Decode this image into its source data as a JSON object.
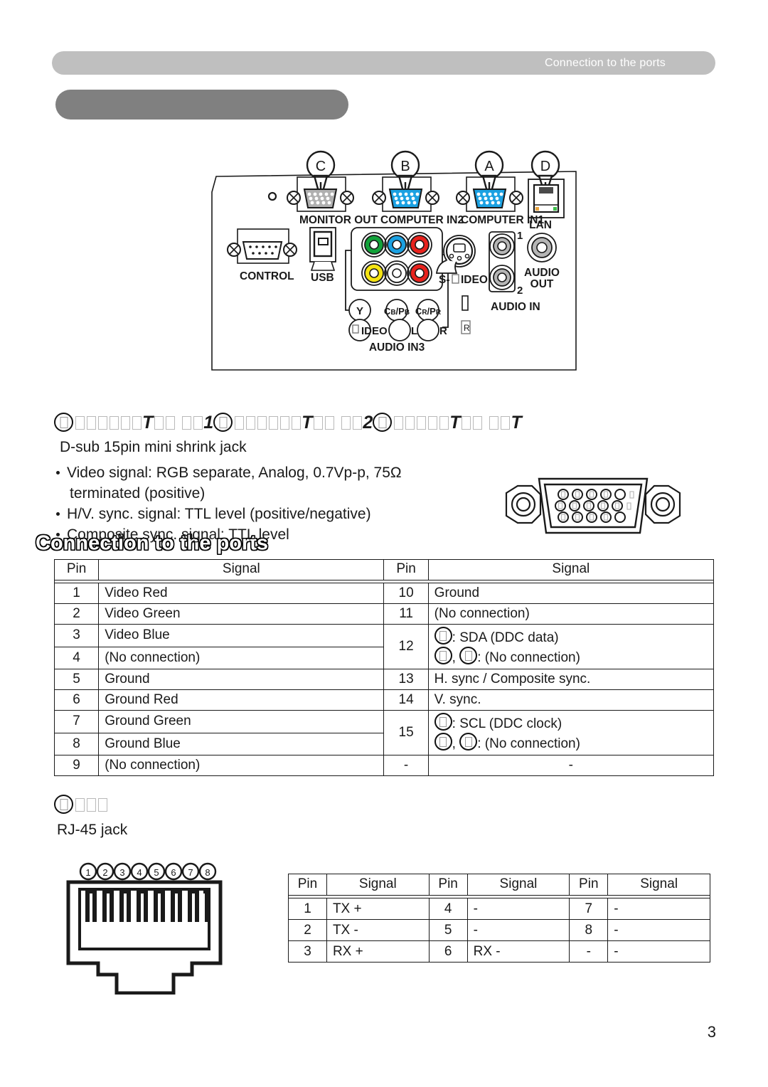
{
  "header": {
    "running_title": "Connection to the ports",
    "bar_color": "#bfbfbf"
  },
  "title": {
    "text": "Connection to the ports",
    "pill_color": "#808080"
  },
  "panel_diagram": {
    "callouts": [
      "C",
      "B",
      "A",
      "D"
    ],
    "port_labels": {
      "monitor_out": "MONITOR OUT",
      "computer_in2": "COMPUTER IN2",
      "computer_in1": "COMPUTER IN1",
      "lan": "LAN",
      "control": "CONTROL",
      "usb": "USB",
      "s_video": "S-",
      "s_video_rest": "IDEO",
      "audio_out_1": "AUDIO",
      "audio_out_2": "OUT",
      "audio_in": "AUDIO IN",
      "audio_in_1": "1",
      "audio_in_2": "2",
      "component_y": "Y",
      "component_cb": "C",
      "component_cb_sub": "B/P",
      "component_cb_sub2": "B",
      "component_cr": "C",
      "component_cr_sub": "R/P",
      "component_cr_sub2": "R",
      "video": "IDEO",
      "audio_l": "L",
      "audio_r": "R",
      "audio_in3": "AUDIO IN3"
    },
    "jack_colors": {
      "monitor_out": "#b0b0b0",
      "computer_in": "#1ba1e2",
      "comp_green": "#12a23a",
      "comp_blue": "#1ba1e2",
      "comp_red": "#e8221d",
      "comp_yellow": "#f5e413",
      "comp_white": "#ffffff"
    }
  },
  "section_vga": {
    "heading_parts": [
      "A",
      "COMPUTER IN",
      "1",
      "B",
      "COMPUTER IN",
      "2",
      "C",
      "MONITOR OUT"
    ],
    "subtitle": "D-sub 15pin mini shrink jack",
    "bullets": [
      {
        "line1": "Video signal: RGB separate, Analog, 0.7Vp-p, 75Ω",
        "line2": "terminated (positive)"
      },
      {
        "line1": "H/V. sync. signal: TTL level (positive/negative)",
        "line2": ""
      },
      {
        "line1": "Composite sync. signal: TTL level",
        "line2": ""
      }
    ],
    "table": {
      "headers": [
        "Pin",
        "Signal",
        "Pin",
        "Signal"
      ],
      "left_rows": [
        {
          "pin": "1",
          "signal": "Video Red"
        },
        {
          "pin": "2",
          "signal": "Video Green"
        },
        {
          "pin": "3",
          "signal": "Video Blue"
        },
        {
          "pin": "4",
          "signal": "(No connection)"
        },
        {
          "pin": "5",
          "signal": "Ground"
        },
        {
          "pin": "6",
          "signal": "Ground Red"
        },
        {
          "pin": "7",
          "signal": "Ground Green"
        },
        {
          "pin": "8",
          "signal": "Ground Blue"
        },
        {
          "pin": "9",
          "signal": "(No connection)"
        }
      ],
      "right_rows": [
        {
          "pin": "10",
          "signal": "Ground",
          "span": 1,
          "multi": false
        },
        {
          "pin": "11",
          "signal": "(No connection)",
          "span": 1,
          "multi": false
        },
        {
          "pin": "12",
          "span": 2,
          "multi": true,
          "l1": ": SDA (DDC data)",
          "l2_sep": ", ",
          "l2": ": (No connection)"
        },
        {
          "pin": "13",
          "signal": "H. sync / Composite sync.",
          "span": 1,
          "multi": false
        },
        {
          "pin": "14",
          "signal": "V. sync.",
          "span": 1,
          "multi": false
        },
        {
          "pin": "15",
          "span": 2,
          "multi": true,
          "l1": ": SCL (DDC clock)",
          "l2_sep": ", ",
          "l2": ": (No connection)"
        },
        {
          "pin": "-",
          "signal": "-",
          "span": 1,
          "multi": false,
          "center": true
        }
      ]
    }
  },
  "section_lan": {
    "heading_parts": [
      "D",
      "LAN"
    ],
    "subtitle": "RJ-45 jack",
    "pin_numbers": [
      "1",
      "2",
      "3",
      "4",
      "5",
      "6",
      "7",
      "8"
    ],
    "table": {
      "headers": [
        "Pin",
        "Signal",
        "Pin",
        "Signal",
        "Pin",
        "Signal"
      ],
      "rows": [
        [
          "1",
          "TX +",
          "4",
          "-",
          "7",
          "-"
        ],
        [
          "2",
          "TX -",
          "5",
          "-",
          "8",
          "-"
        ],
        [
          "3",
          "RX +",
          "6",
          "RX -",
          "-",
          "-"
        ]
      ]
    }
  },
  "footer": {
    "page_number": "3"
  }
}
